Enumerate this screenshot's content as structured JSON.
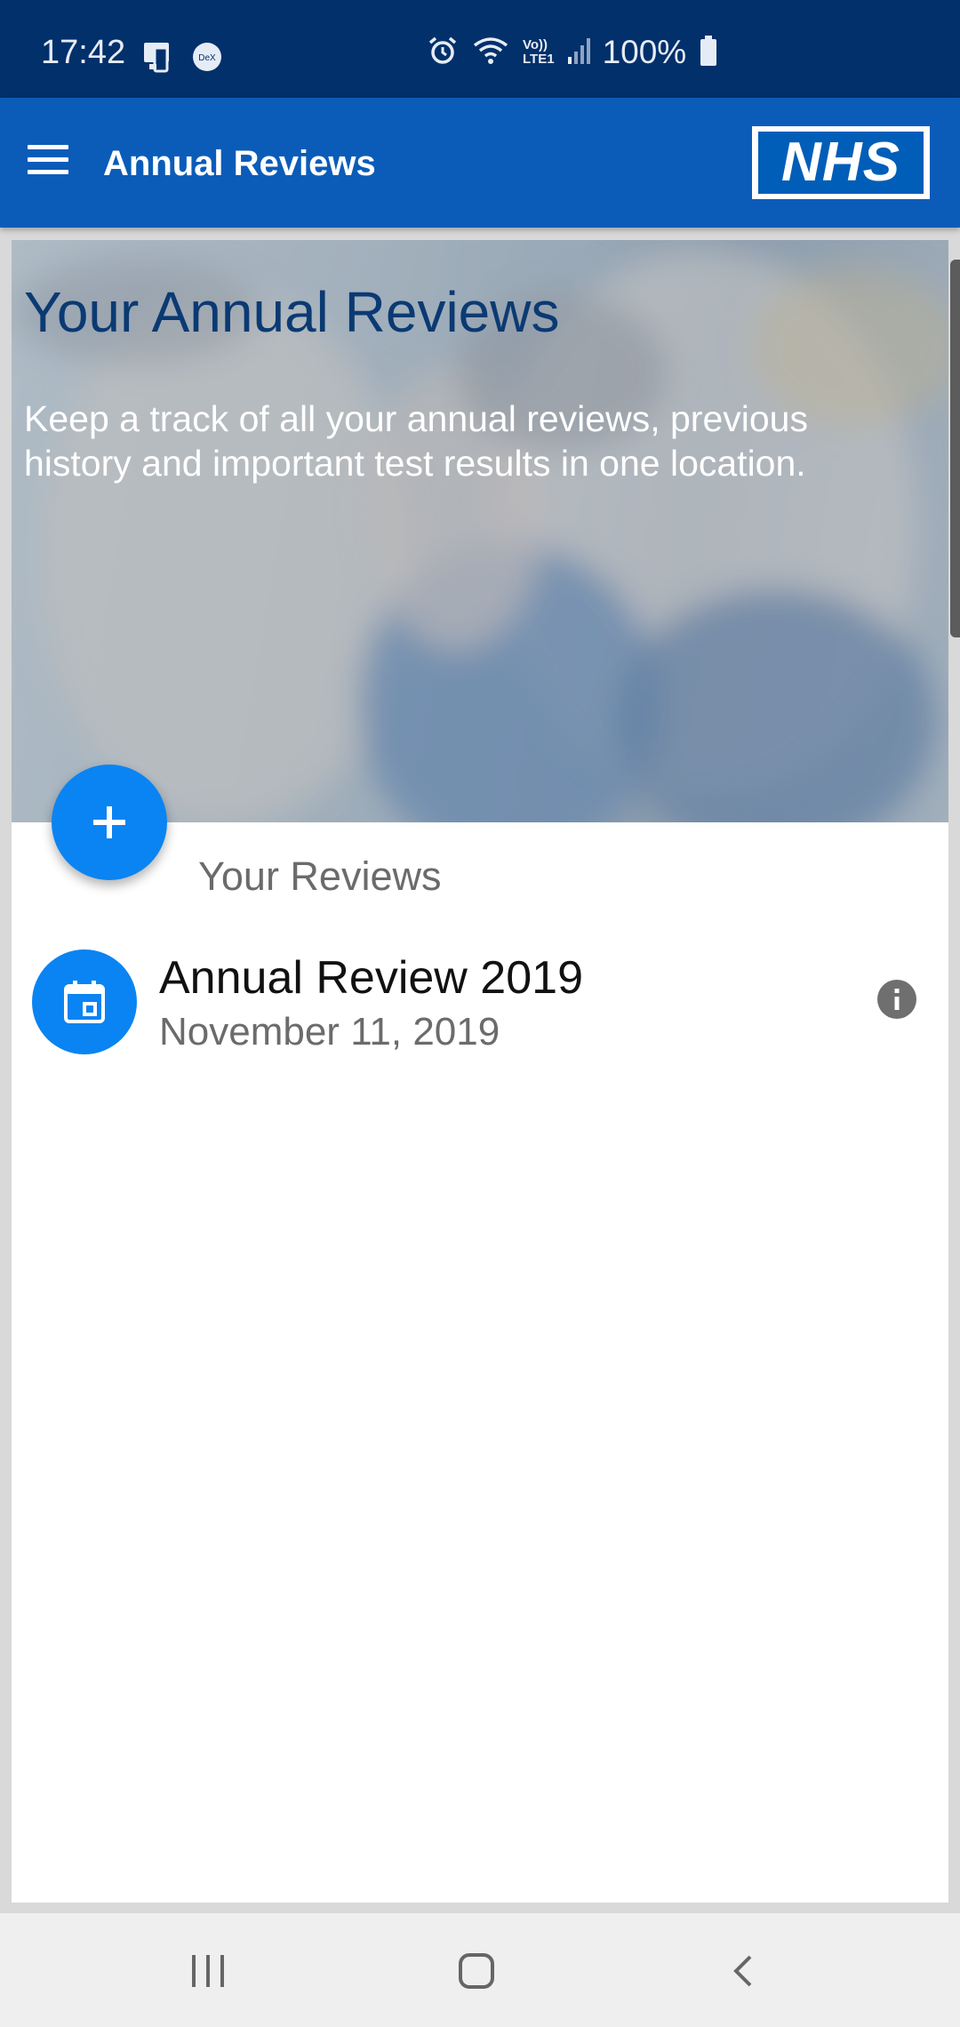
{
  "status_bar": {
    "time": "17:42",
    "battery": "100%",
    "left_icons": [
      "dex-device-icon",
      "dex-icon"
    ],
    "right_icons": [
      "alarm-icon",
      "wifi-icon",
      "volte-icon",
      "signal-icon",
      "battery-icon"
    ],
    "volte_line1": "Vo))",
    "volte_line2": "LTE1"
  },
  "app_bar": {
    "title": "Annual Reviews",
    "logo_text": "NHS"
  },
  "hero": {
    "title": "Your Annual Reviews",
    "text": "Keep a track of all your annual reviews, previous history and important test results in one location."
  },
  "reviews": {
    "heading": "Your Reviews",
    "items": [
      {
        "title": "Annual Review 2019",
        "date": "November 11, 2019"
      }
    ]
  },
  "colors": {
    "status_bar": "#02306b",
    "app_bar": "#0b5cb8",
    "accent": "#0a84f2",
    "hero_title": "#0b3a73"
  },
  "nav": {
    "icons": [
      "recent-apps-icon",
      "home-icon",
      "back-icon"
    ]
  }
}
